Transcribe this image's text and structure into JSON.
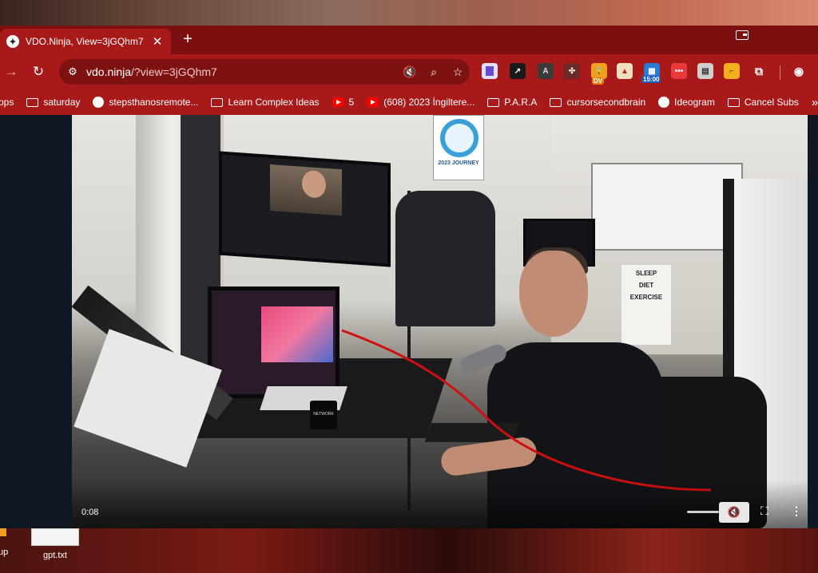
{
  "browser": {
    "tab": {
      "title": "VDO.Ninja, View=3jGQhm7",
      "close": "✕"
    },
    "new_tab": "+",
    "url_host": "vdo.ninja",
    "url_path": "/?view=3jGQhm7",
    "icons": {
      "back": "arrow-left-icon",
      "reload": "reload-icon",
      "site_info": "tune-icon",
      "mute": "speaker-muted-icon",
      "zoom": "magnifier-icon",
      "star": "star-icon"
    },
    "extensions": [
      {
        "name": "ext-book",
        "label": "",
        "color": "#e0e0ff"
      },
      {
        "name": "ext-arrow",
        "label": "",
        "color": "#222222"
      },
      {
        "name": "ext-a",
        "label": "A",
        "color": "#333333"
      },
      {
        "name": "ext-puzzle-dark",
        "label": "",
        "color": "#5a2a2a"
      },
      {
        "name": "ext-lock",
        "label": "",
        "color": "#f0a020",
        "badge": "DV"
      },
      {
        "name": "ext-flag",
        "label": "",
        "color": "#e84a4a"
      },
      {
        "name": "ext-calendar",
        "label": "",
        "color": "#2a7ad8",
        "badge": "15:00"
      },
      {
        "name": "ext-dots",
        "label": "•••",
        "color": "#e83a3a"
      },
      {
        "name": "ext-print",
        "label": "",
        "color": "#cfcfcf"
      },
      {
        "name": "ext-ruler",
        "label": "",
        "color": "#f0b020"
      },
      {
        "name": "ext-puzzle",
        "label": "",
        "color": "#a81a1a"
      },
      {
        "name": "ext-profile",
        "label": "",
        "color": "#a81a1a"
      }
    ],
    "bookmarks": [
      {
        "label": "pps",
        "icon": "apps-icon"
      },
      {
        "label": "saturday",
        "icon": "folder-icon"
      },
      {
        "label": "stepsthanosremote...",
        "icon": "github-icon"
      },
      {
        "label": "Learn Complex Ideas",
        "icon": "folder-icon"
      },
      {
        "label": "5",
        "icon": "youtube-icon"
      },
      {
        "label": "(608) 2023 İngiltere...",
        "icon": "youtube-icon"
      },
      {
        "label": "P.A.R.A",
        "icon": "folder-icon"
      },
      {
        "label": "cursorsecondbrain",
        "icon": "folder-icon"
      },
      {
        "label": "Ideogram",
        "icon": "ideogram-icon"
      },
      {
        "label": "Cancel Subs",
        "icon": "folder-icon"
      }
    ],
    "bookmarks_more": "»"
  },
  "video": {
    "time": "0:08",
    "poster_text": "2023 JOURNEY",
    "sign_lines": [
      "SLEEP",
      "DIET",
      "EXERCISE"
    ],
    "mug_text": "NETWORK",
    "controls": {
      "mute": "🔇",
      "fullscreen": "⛶",
      "menu": "⋮"
    }
  },
  "desktop": {
    "left_label": "up",
    "file_label": "gpt.txt"
  }
}
